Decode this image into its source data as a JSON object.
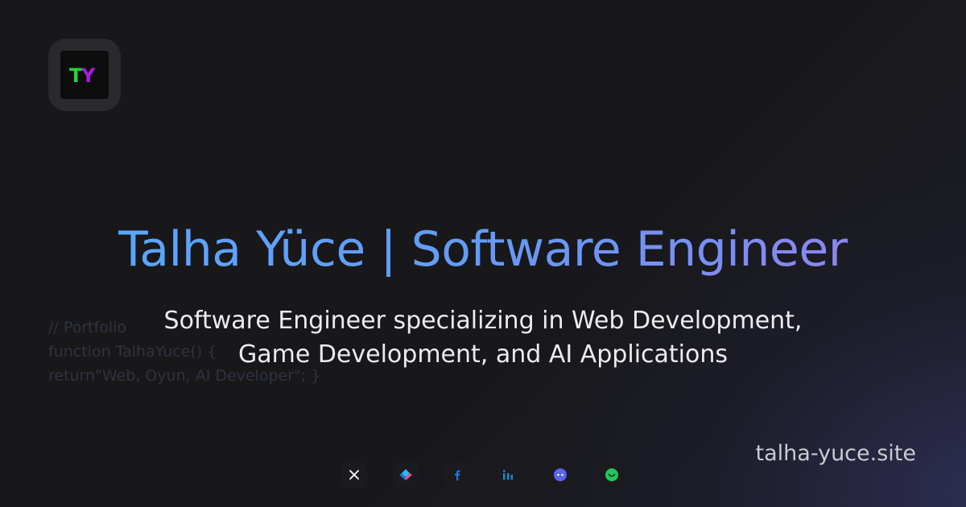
{
  "logo": {
    "letter_t": "T",
    "letter_y": "Y",
    "t_color": "#22d63a",
    "y_color": "#a51ce0"
  },
  "title": "Talha Yüce | Software Engineer",
  "code": {
    "line1": "// Portfolio",
    "line2": "function TalhaYuce() {",
    "line3": "return\"Web, Oyun, AI Developer\"; }"
  },
  "subtitle": {
    "line1": "Software Engineer specializing in Web Development,",
    "line2": "Game Development, and AI Applications"
  },
  "site": "talha-yuce.site",
  "socials": [
    {
      "icon": "x-icon",
      "color": "#ffffff"
    },
    {
      "icon": "dart-icon",
      "color": "#2bb7f6"
    },
    {
      "icon": "facebook-icon",
      "color": "#1877f2"
    },
    {
      "icon": "linkedin-icon",
      "color": "#1a8cd8"
    },
    {
      "icon": "discord-icon",
      "color": "#5865f2"
    },
    {
      "icon": "smile-icon",
      "color": "#22c55e"
    }
  ],
  "colors": {
    "background": "#18181b",
    "title_gradient_start": "#5aa6ff",
    "title_gradient_end": "#8b86f0",
    "subtitle": "#ececf0",
    "code": "#2f3340"
  }
}
